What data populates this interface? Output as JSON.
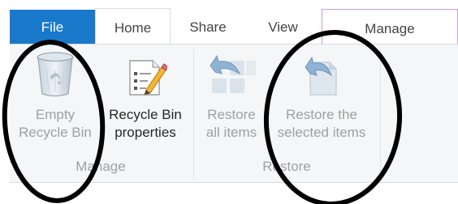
{
  "tabs": {
    "file": "File",
    "home": "Home",
    "share": "Share",
    "view": "View",
    "manage": "Manage"
  },
  "ribbon": {
    "groups": {
      "manage": {
        "label": "Manage",
        "buttons": {
          "empty_recycle_bin": "Empty\nRecycle Bin",
          "recycle_bin_properties": "Recycle Bin\nproperties"
        }
      },
      "restore": {
        "label": "Restore",
        "buttons": {
          "restore_all_items": "Restore\nall items",
          "restore_selected_items": "Restore the\nselected items"
        }
      }
    }
  },
  "colors": {
    "file_tab": "#1979ca",
    "manage_tab_border": "#c89ed6",
    "ribbon_bg": "#f5f6f7",
    "disabled_text": "#a0a0a0",
    "enabled_text": "#262626",
    "annotation_ovals": "#000000"
  },
  "icons": {
    "empty_recycle_bin": "recycle-bin-icon",
    "recycle_bin_properties": "properties-icon",
    "restore_all_items": "restore-all-icon",
    "restore_selected_items": "restore-selected-icon"
  }
}
